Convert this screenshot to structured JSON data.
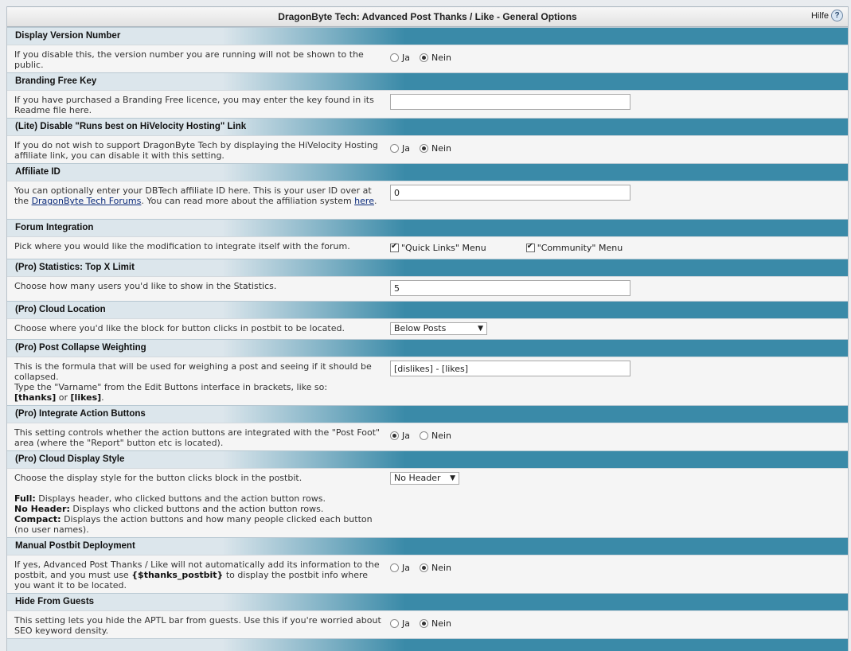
{
  "header": {
    "title": "DragonByte Tech: Advanced Post Thanks / Like - General Options",
    "help_label": "Hilfe",
    "help_icon": "?"
  },
  "radio_labels": {
    "yes": "Ja",
    "no": "Nein"
  },
  "sections": {
    "version": {
      "title": "Display Version Number",
      "desc": "If you disable this, the version number you are running will not be shown to the public.",
      "selected": "Nein"
    },
    "branding": {
      "title": "Branding Free Key",
      "desc": "If you have purchased a Branding Free licence, you may enter the key found in its Readme file here.",
      "value": ""
    },
    "lite_link": {
      "title": "(Lite) Disable \"Runs best on HiVelocity Hosting\" Link",
      "desc": "If you do not wish to support DragonByte Tech by displaying the HiVelocity Hosting affiliate link, you can disable it with this setting.",
      "selected": "Nein"
    },
    "affiliate": {
      "title": "Affiliate ID",
      "desc_1": "You can optionally enter your DBTech affiliate ID here. This is your user ID over at the ",
      "link_forums": "DragonByte Tech Forums",
      "desc_2": ". You can read more about the affiliation system ",
      "link_here": "here",
      "desc_3": ".",
      "value": "0"
    },
    "forum": {
      "title": "Forum Integration",
      "desc": "Pick where you would like the modification to integrate itself with the forum.",
      "options": [
        "\"Quick Links\" Menu",
        "\"Community\" Menu"
      ]
    },
    "stats": {
      "title": "(Pro) Statistics: Top X Limit",
      "desc": "Choose how many users you'd like to show in the Statistics.",
      "value": "5"
    },
    "cloud_location": {
      "title": "(Pro) Cloud Location",
      "desc": "Choose where you'd like the block for button clicks in postbit to be located.",
      "selected": "Below Posts"
    },
    "collapse": {
      "title": "(Pro) Post Collapse Weighting",
      "desc_1": "This is the formula that will be used for weighing a post and seeing if it should be collapsed.",
      "desc_2": "Type the \"Varname\" from the Edit Buttons interface in brackets, like so:",
      "bold_thanks": "[thanks]",
      "or": " or ",
      "bold_likes": "[likes]",
      "period": ".",
      "value": "[dislikes] - [likes]"
    },
    "action_buttons": {
      "title": "(Pro) Integrate Action Buttons",
      "desc": "This setting controls whether the action buttons are integrated with the \"Post Foot\" area (where the \"Report\" button etc is located).",
      "selected": "Ja"
    },
    "display_style": {
      "title": "(Pro) Cloud Display Style",
      "desc": "Choose the display style for the button clicks block in the postbit.",
      "full_label": "Full:",
      "full_text": " Displays header, who clicked buttons and the action button rows.",
      "noheader_label": "No Header:",
      "noheader_text": " Displays who clicked buttons and the action button rows.",
      "compact_label": "Compact:",
      "compact_text": " Displays the action buttons and how many people clicked each button (no user names).",
      "selected": "No Header"
    },
    "manual": {
      "title": "Manual Postbit Deployment",
      "desc_1": "If yes, Advanced Post Thanks / Like will not automatically add its information to the postbit, and you must use ",
      "code": "{$thanks_postbit}",
      "desc_2": " to display the postbit info where you want it to be located.",
      "selected": "Nein"
    },
    "guests": {
      "title": "Hide From Guests",
      "desc": "This setting lets you hide the APTL bar from guests. Use this if you're worried about SEO keyword density.",
      "selected": "Nein"
    }
  }
}
